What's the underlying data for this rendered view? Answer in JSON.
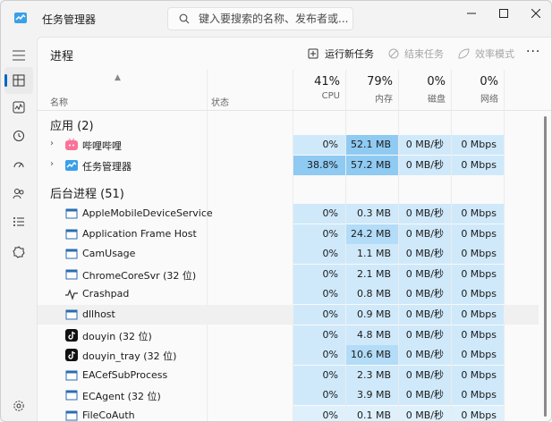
{
  "window": {
    "title": "任务管理器",
    "search_placeholder": "键入要搜索的名称、发布者或...",
    "controls": [
      "minimize",
      "maximize",
      "close"
    ]
  },
  "nav": {
    "items": [
      "processes",
      "performance",
      "app-history",
      "startup-apps",
      "users",
      "details",
      "services"
    ],
    "bottom": "settings",
    "active": "processes"
  },
  "toolbar": {
    "page_title": "进程",
    "run_task": "运行新任务",
    "end_task": "结束任务",
    "efficiency_mode": "效率模式",
    "more": "···"
  },
  "columns": {
    "name": "名称",
    "status": "状态",
    "cpu": {
      "pct": "41%",
      "label": "CPU"
    },
    "mem": {
      "pct": "79%",
      "label": "内存"
    },
    "disk": {
      "pct": "0%",
      "label": "磁盘"
    },
    "net": {
      "pct": "0%",
      "label": "网络"
    }
  },
  "apps_section": "应用 (2)",
  "apps": [
    {
      "name": "哔哩哔哩",
      "cpu": "0%",
      "mem": "52.1 MB",
      "disk": "0 MB/秒",
      "net": "0 Mbps",
      "icon": "bilibili-icon"
    },
    {
      "name": "任务管理器",
      "cpu": "38.8%",
      "mem": "57.2 MB",
      "disk": "0 MB/秒",
      "net": "0 Mbps",
      "icon": "task-manager-icon"
    }
  ],
  "bg_section": "后台进程 (51)",
  "background": [
    {
      "name": "AppleMobileDeviceService",
      "cpu": "0%",
      "mem": "0.3 MB",
      "disk": "0 MB/秒",
      "net": "0 Mbps",
      "icon": "window-icon"
    },
    {
      "name": "Application Frame Host",
      "cpu": "0%",
      "mem": "24.2 MB",
      "disk": "0 MB/秒",
      "net": "0 Mbps",
      "icon": "window-icon"
    },
    {
      "name": "CamUsage",
      "cpu": "0%",
      "mem": "1.1 MB",
      "disk": "0 MB/秒",
      "net": "0 Mbps",
      "icon": "window-icon"
    },
    {
      "name": "ChromeCoreSvr (32 位)",
      "cpu": "0%",
      "mem": "2.1 MB",
      "disk": "0 MB/秒",
      "net": "0 Mbps",
      "icon": "window-icon"
    },
    {
      "name": "Crashpad",
      "cpu": "0%",
      "mem": "0.8 MB",
      "disk": "0 MB/秒",
      "net": "0 Mbps",
      "icon": "pulse-icon"
    },
    {
      "name": "dllhost",
      "cpu": "0%",
      "mem": "0.9 MB",
      "disk": "0 MB/秒",
      "net": "0 Mbps",
      "icon": "window-icon"
    },
    {
      "name": "douyin (32 位)",
      "cpu": "0%",
      "mem": "4.8 MB",
      "disk": "0 MB/秒",
      "net": "0 Mbps",
      "icon": "douyin-icon"
    },
    {
      "name": "douyin_tray (32 位)",
      "cpu": "0%",
      "mem": "10.6 MB",
      "disk": "0 MB/秒",
      "net": "0 Mbps",
      "icon": "douyin-icon"
    },
    {
      "name": "EACefSubProcess",
      "cpu": "0%",
      "mem": "2.3 MB",
      "disk": "0 MB/秒",
      "net": "0 Mbps",
      "icon": "window-icon"
    },
    {
      "name": "ECAgent (32 位)",
      "cpu": "0%",
      "mem": "3.9 MB",
      "disk": "0 MB/秒",
      "net": "0 Mbps",
      "icon": "window-icon"
    },
    {
      "name": "FileCoAuth",
      "cpu": "0%",
      "mem": "0.1 MB",
      "disk": "0 MB/秒",
      "net": "0 Mbps",
      "icon": "window-icon"
    }
  ],
  "colors": {
    "accent": "#0067c0",
    "heat_light": "#cfe9fb",
    "heat_mid": "#b2dcf7",
    "heat_strong": "#8fcaf2"
  }
}
